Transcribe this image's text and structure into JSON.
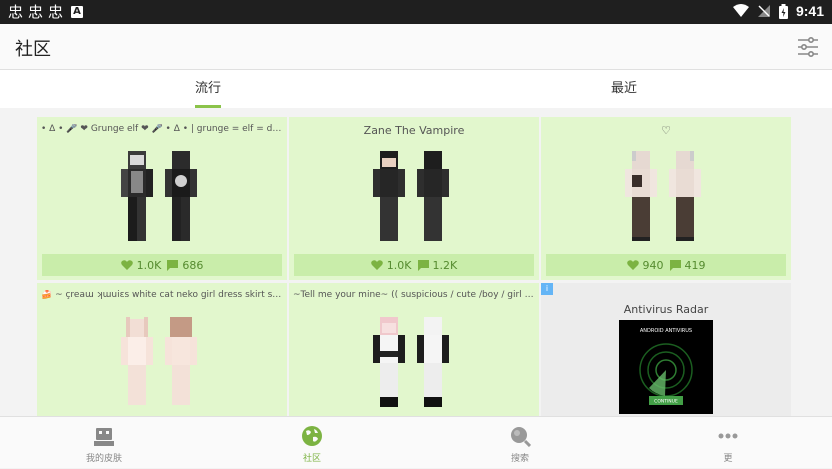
{
  "status_bar": {
    "time": "9:41",
    "glyphs": [
      "忠",
      "忠",
      "忠"
    ],
    "a_badge": "A"
  },
  "app_bar": {
    "title": "社区",
    "filter_icon": "tune-icon"
  },
  "tabs": [
    {
      "label": "流行",
      "active": true
    },
    {
      "label": "最近",
      "active": false
    }
  ],
  "cards": [
    {
      "title": "• Δ • 🎤 ❤ Grunge elf ❤ 🎤 • Δ • | grunge = elf = dark = ...",
      "likes": "1.0K",
      "comments": "686"
    },
    {
      "title": "Zane The Vampire",
      "likes": "1.0K",
      "comments": "1.2K"
    },
    {
      "title": "♡",
      "likes": "940",
      "comments": "419"
    },
    {
      "title": "🍰 ~ çreaɯ ʞɯuiεs white cat neko girl dress skirt stoc...",
      "likes": "",
      "comments": ""
    },
    {
      "title": "~Tell me your mine~ (( suspicious / cute /boy / girl / pi...",
      "likes": "",
      "comments": ""
    }
  ],
  "ad": {
    "title": "Antivirus Radar",
    "badge": "i",
    "img_heading": "ANDROID ANTIVIRUS",
    "img_button": "CONTINUE"
  },
  "bottom_nav": [
    {
      "label": "我的皮肤",
      "icon": "robot-icon",
      "active": false
    },
    {
      "label": "社区",
      "icon": "globe-icon",
      "active": true
    },
    {
      "label": "搜索",
      "icon": "search-icon",
      "active": false
    },
    {
      "label": "更",
      "icon": "more-icon",
      "active": false
    }
  ],
  "colors": {
    "accent": "#8bc34a",
    "card_bg": "#e2f7cd",
    "stats_bg": "#c9edaa",
    "stats_text": "#558b2f"
  }
}
